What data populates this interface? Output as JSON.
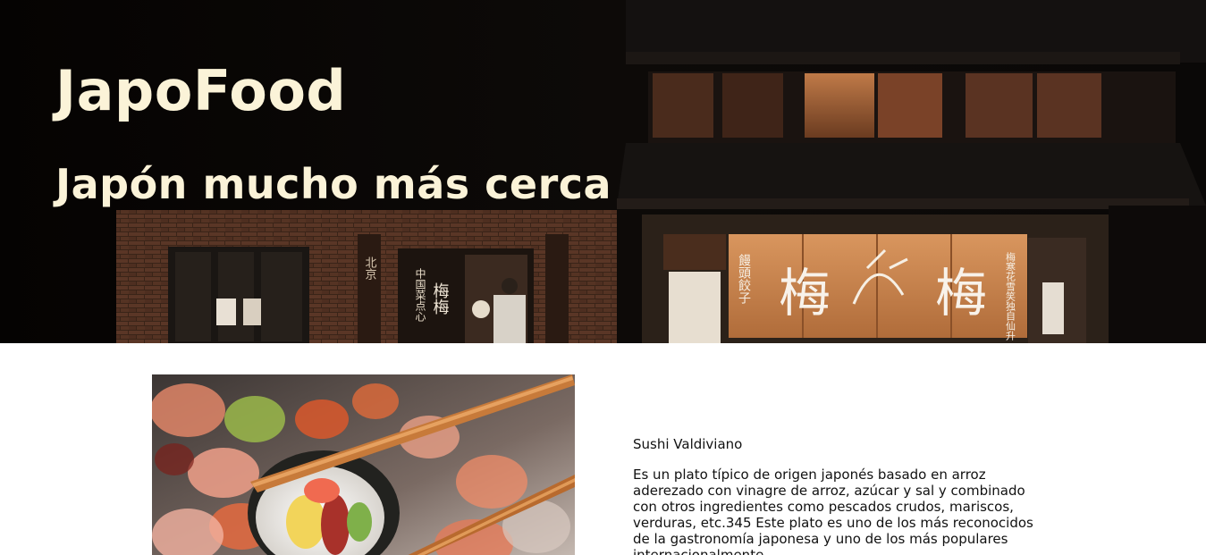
{
  "hero": {
    "title": "JapoFood",
    "subtitle": "Japón mucho más cerca",
    "sign_left": "北京",
    "sign_door": "中国菜点心",
    "sign_door_right": "梅梅",
    "curtain_char": "梅",
    "curtain_small_left": "饅頭餃子",
    "curtain_small_right": "梅寒花雪笑独自仙升"
  },
  "dish": {
    "name": "Sushi Valdiviano",
    "description": "Es un plato típico de origen japonés basado en arroz aderezado con vinagre de arroz, azúcar y sal y combinado con otros ingredientes como pescados crudos, mariscos, verduras, etc.345 Este plato es uno de los más reconocidos de la gastronomía japonesa y uno de los más populares internacionalmente."
  },
  "colors": {
    "title_text": "#fbf3d8",
    "body_text": "#111111",
    "background": "#ffffff"
  }
}
